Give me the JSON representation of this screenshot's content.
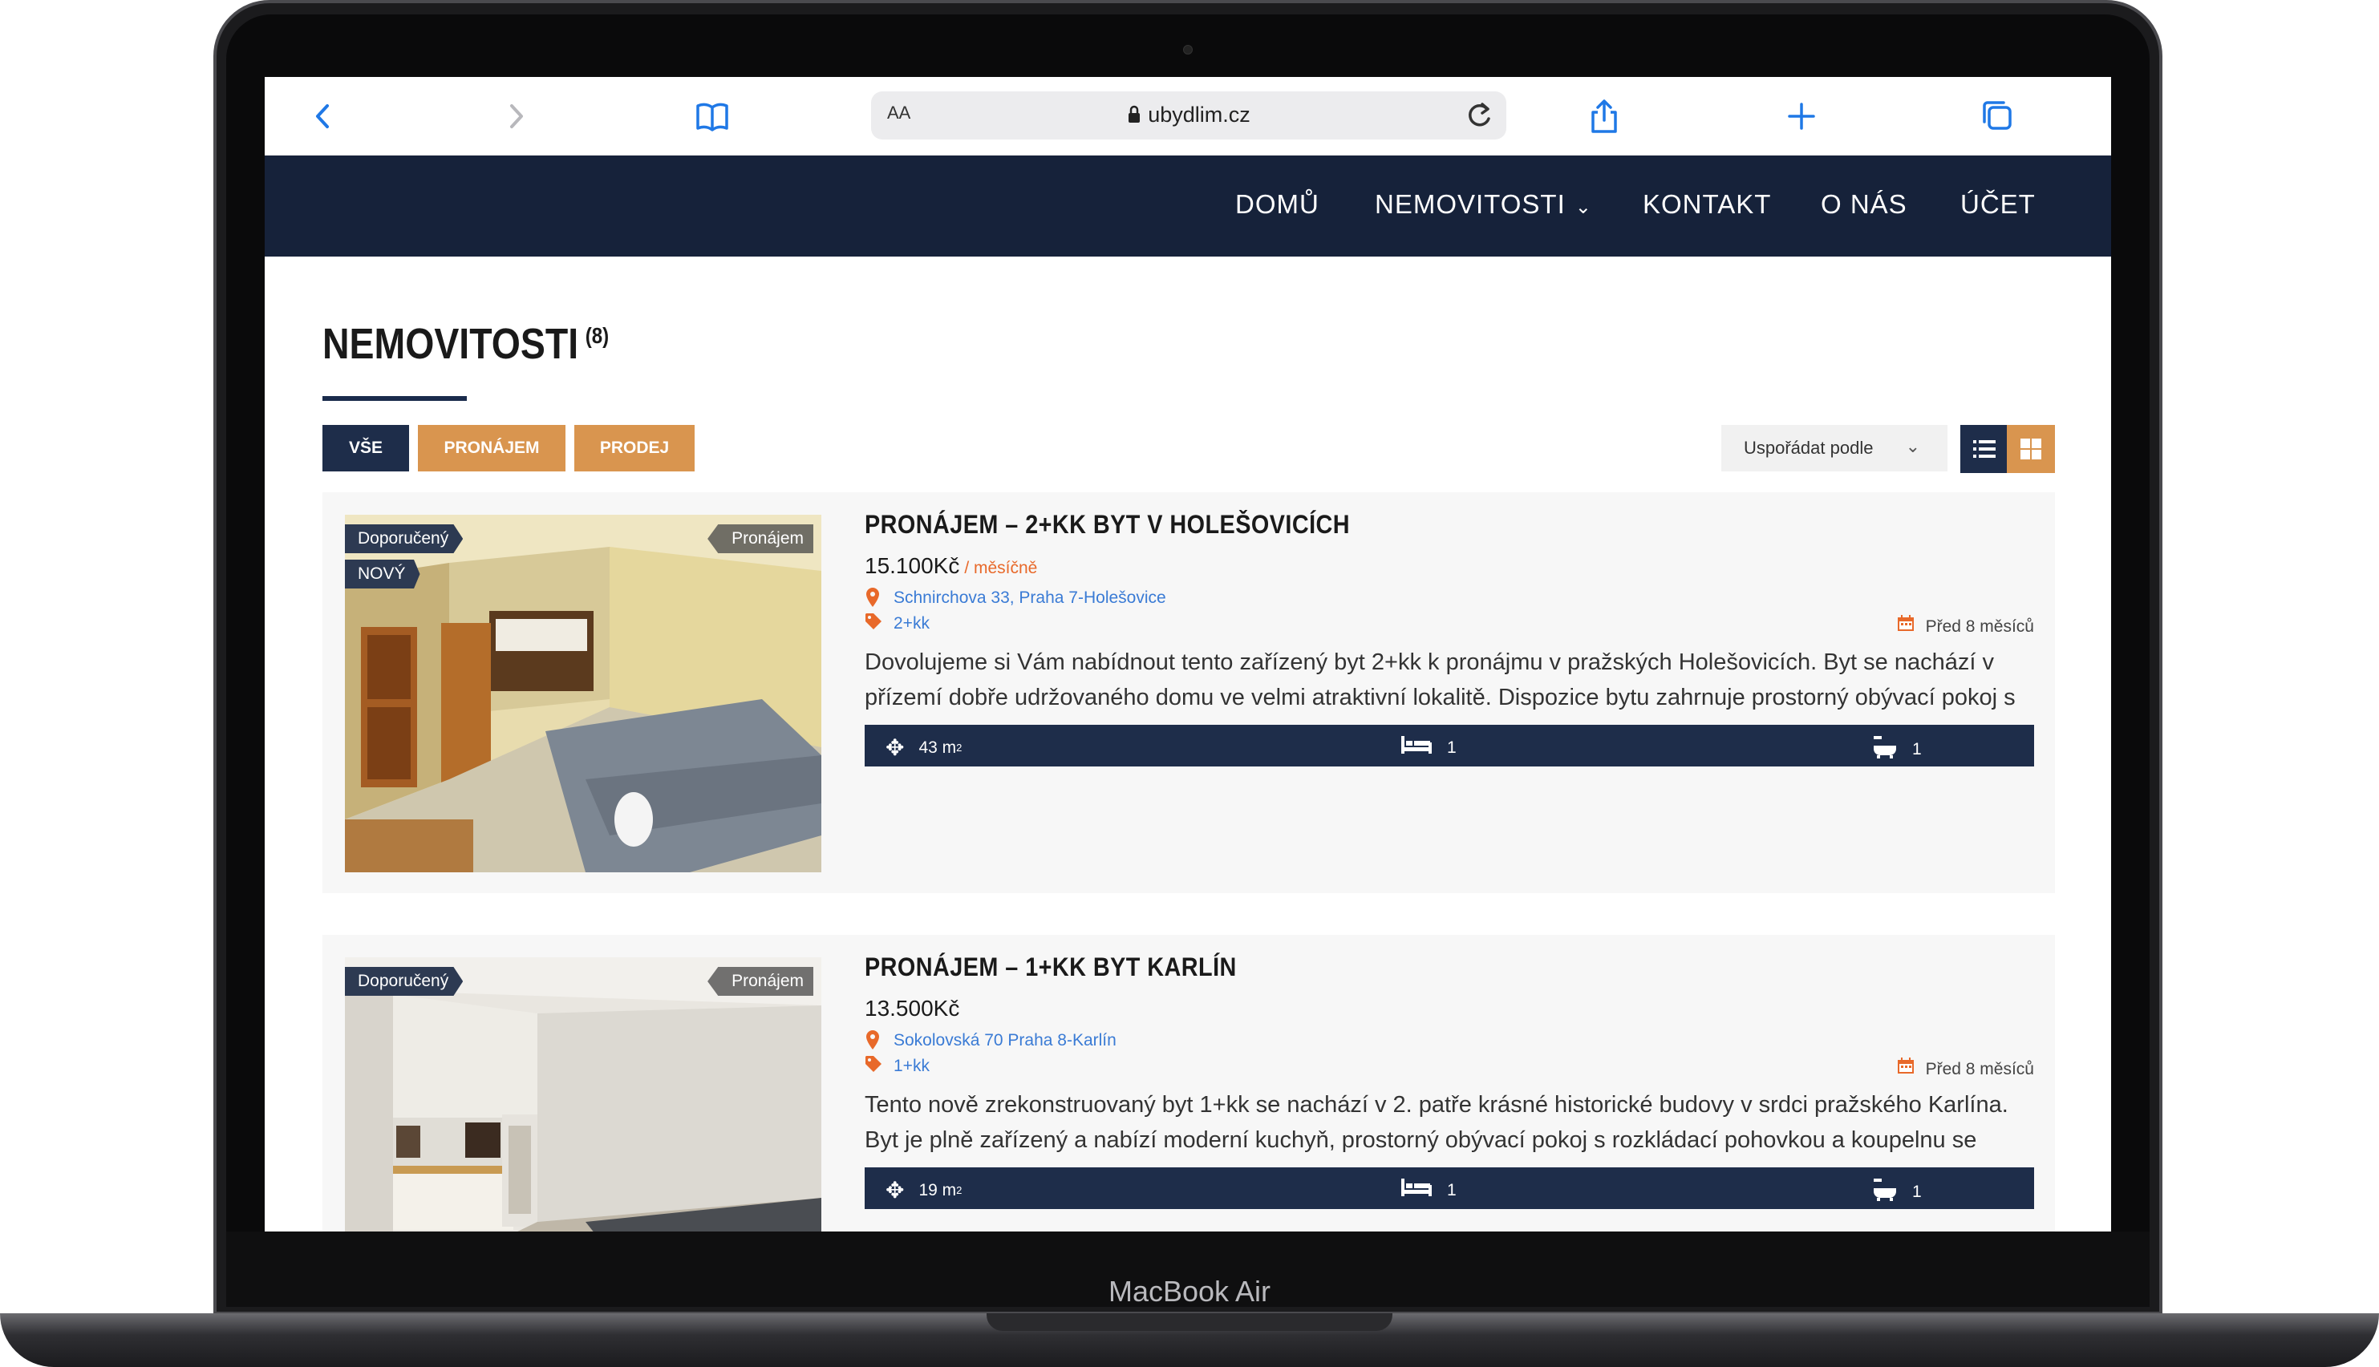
{
  "device": {
    "label": "MacBook Air"
  },
  "browser": {
    "aa_label": "AA",
    "url": "ubydlim.cz",
    "icons": [
      "back-icon",
      "forward-icon",
      "bookmarks-icon",
      "lock-icon",
      "reload-icon",
      "share-icon",
      "new-tab-icon",
      "tabs-icon"
    ]
  },
  "nav": {
    "items": [
      {
        "label": "DOMŮ"
      },
      {
        "label": "NEMOVITOSTI"
      },
      {
        "label": "KONTAKT"
      },
      {
        "label": "O NÁS"
      },
      {
        "label": "ÚČET"
      }
    ]
  },
  "page": {
    "title": "NEMOVITOSTI",
    "count": "(8)",
    "filters": [
      {
        "label": "VŠE"
      },
      {
        "label": "PRONÁJEM"
      },
      {
        "label": "PRODEJ"
      }
    ],
    "sort_label": "Uspořádat podle",
    "colors": {
      "navy": "#1e2d4a",
      "orange": "#d9954f",
      "accent": "#e8692a",
      "link": "#3a7bd5"
    }
  },
  "listings": [
    {
      "tags": [
        "Doporučený",
        "NOVÝ"
      ],
      "type_tag": "Pronájem",
      "title": "PRONÁJEM – 2+KK BYT V HOLEŠOVICÍCH",
      "price": "15.100Kč",
      "period": "/ měsíčně",
      "address": "Schnirchova 33, Praha 7-Holešovice",
      "layout": "2+kk",
      "date": "Před 8 měsíců",
      "description": "Dovolujeme si Vám nabídnout tento zařízený byt 2+kk k pronájmu v pražských Holešovicích. Byt se nachází v přízemí dobře udržovaného domu ve velmi atraktivní lokalitě. Dispozice bytu zahrnuje prostorný obývací pokoj s",
      "area": "43",
      "area_unit": "m",
      "area_exp": "2",
      "beds": "1",
      "baths": "1"
    },
    {
      "tags": [
        "Doporučený"
      ],
      "type_tag": "Pronájem",
      "title": "PRONÁJEM – 1+KK BYT KARLÍN",
      "price": "13.500Kč",
      "period": "",
      "address": "Sokolovská 70 Praha 8-Karlín",
      "layout": "1+kk",
      "date": "Před 8 měsíců",
      "description": "Tento nově zrekonstruovaný byt 1+kk se nachází v 2. patře krásné historické budovy v srdci pražského Karlína. Byt je plně zařízený a nabízí moderní kuchyň, prostorný obývací pokoj s rozkládací pohovkou a koupelnu se vanou. Byt",
      "area": "19",
      "area_unit": "m",
      "area_exp": "2",
      "beds": "1",
      "baths": "1"
    }
  ]
}
